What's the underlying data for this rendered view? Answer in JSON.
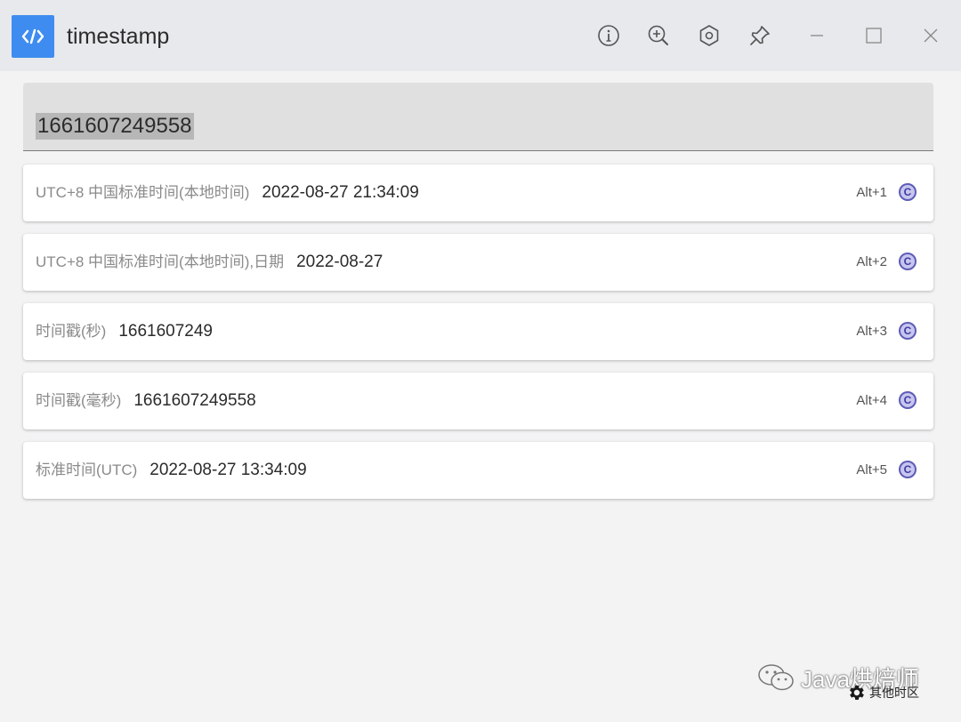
{
  "app": {
    "title": "timestamp",
    "icon": "code-icon",
    "accent_color": "#3f8cf0"
  },
  "toolbar": {
    "buttons": [
      {
        "name": "info-icon"
      },
      {
        "name": "zoom-in-icon"
      },
      {
        "name": "hexagon-settings-icon"
      },
      {
        "name": "pin-icon"
      }
    ],
    "window_controls": [
      "minimize-icon",
      "maximize-icon",
      "close-icon"
    ]
  },
  "search": {
    "value": "1661607249558"
  },
  "results": [
    {
      "label": "UTC+8 中国标准时间(本地时间)",
      "value": "2022-08-27 21:34:09",
      "shortcut": "Alt+1",
      "copy_label": "C"
    },
    {
      "label": "UTC+8 中国标准时间(本地时间),日期",
      "value": "2022-08-27",
      "shortcut": "Alt+2",
      "copy_label": "C"
    },
    {
      "label": "时间戳(秒)",
      "value": "1661607249",
      "shortcut": "Alt+3",
      "copy_label": "C"
    },
    {
      "label": "时间戳(毫秒)",
      "value": "1661607249558",
      "shortcut": "Alt+4",
      "copy_label": "C"
    },
    {
      "label": "标准时间(UTC)",
      "value": "2022-08-27 13:34:09",
      "shortcut": "Alt+5",
      "copy_label": "C"
    }
  ],
  "footer": {
    "settings_label": "其他时区",
    "watermark_text": "Java烘焙师"
  }
}
